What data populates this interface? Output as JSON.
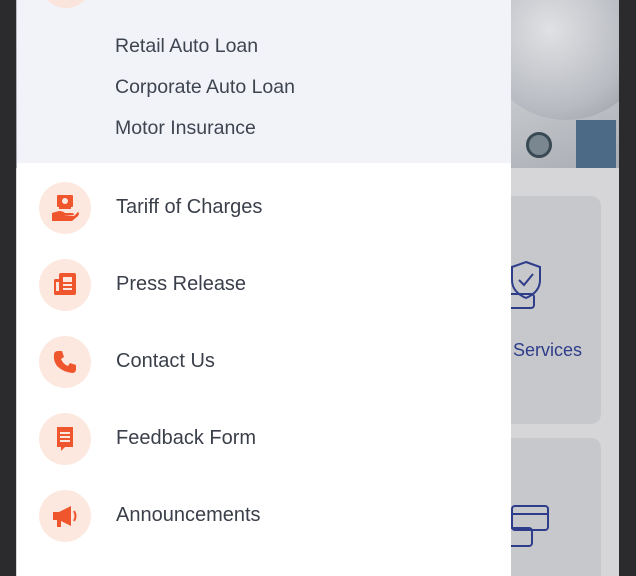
{
  "background": {
    "card_label": "& Services"
  },
  "drawer": {
    "submenu": [
      {
        "label": "Retail Auto Loan"
      },
      {
        "label": "Corporate Auto Loan"
      },
      {
        "label": "Motor Insurance"
      }
    ],
    "items": [
      {
        "label": "Tariff of Charges",
        "icon": "cash-in-hand-icon"
      },
      {
        "label": "Press Release",
        "icon": "newspaper-icon"
      },
      {
        "label": "Contact Us",
        "icon": "phone-icon"
      },
      {
        "label": "Feedback Form",
        "icon": "form-document-icon"
      },
      {
        "label": "Announcements",
        "icon": "megaphone-icon"
      }
    ]
  },
  "colors": {
    "accent": "#f0562e",
    "icon_bg": "#fde8e0",
    "submenu_bg": "#f2f3f8",
    "text": "#3a3f4a",
    "bg_brand_text": "#2e3d8a"
  }
}
